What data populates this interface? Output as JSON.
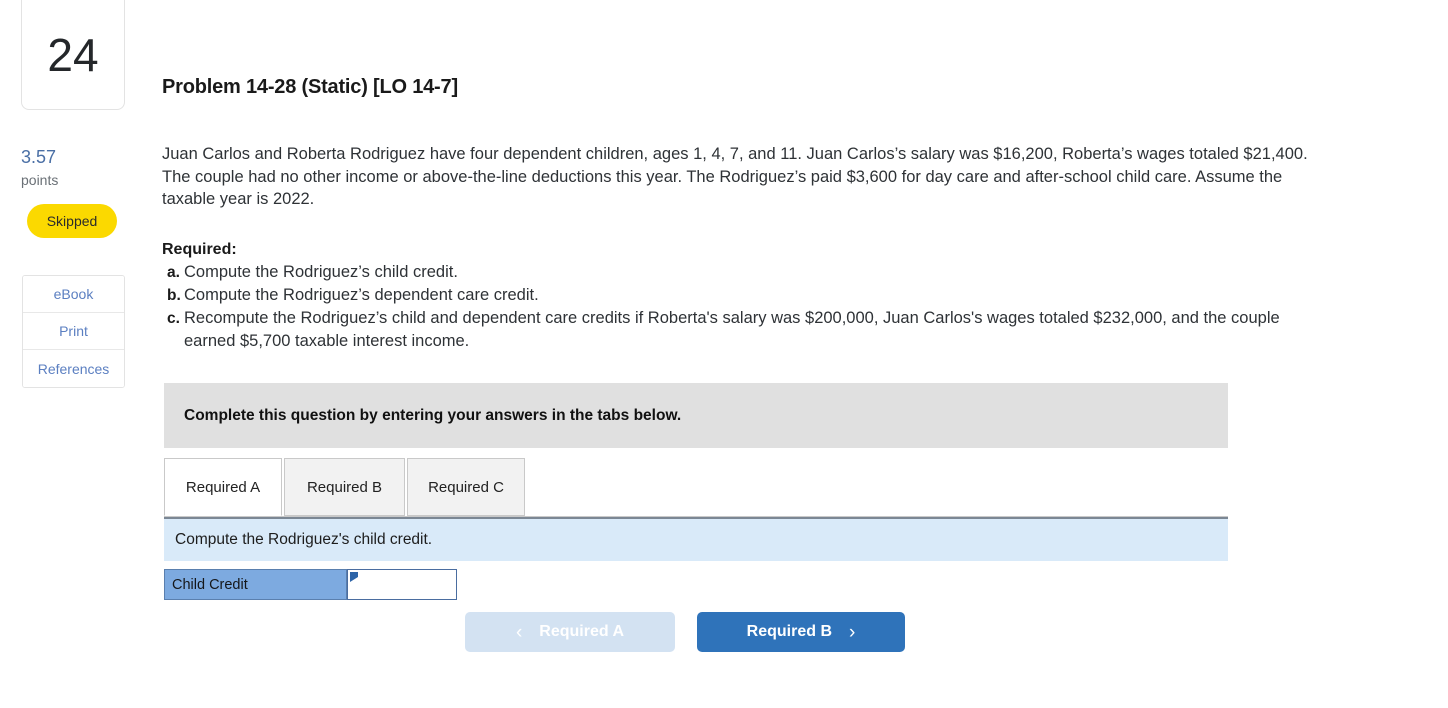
{
  "sidebar": {
    "question_number": "24",
    "points_value": "3.57",
    "points_label": "points",
    "status_badge": "Skipped",
    "tools": [
      {
        "label": "eBook"
      },
      {
        "label": "Print"
      },
      {
        "label": "References"
      }
    ]
  },
  "problem": {
    "title": "Problem 14-28 (Static) [LO 14-7]",
    "body": "Juan Carlos and Roberta Rodriguez have four dependent children, ages 1, 4, 7, and 11. Juan Carlos’s salary was $16,200, Roberta’s wages totaled $21,400. The couple had no other income or above-the-line deductions this year. The Rodriguez’s paid $3,600 for day care and after-school child care. Assume the taxable year is 2022.",
    "required_heading": "Required:",
    "required_items": [
      {
        "letter": "a.",
        "text": "Compute the Rodriguez’s child credit."
      },
      {
        "letter": "b.",
        "text": "Compute the Rodriguez’s dependent care credit."
      },
      {
        "letter": "c.",
        "text": "Recompute the Rodriguez’s child and dependent care credits if Roberta's salary was $200,000, Juan Carlos's wages totaled $232,000, and the couple earned $5,700 taxable interest income."
      }
    ]
  },
  "callout": {
    "text": "Complete this question by entering your answers in the tabs below."
  },
  "tabs": [
    {
      "label": "Required A",
      "active": true
    },
    {
      "label": "Required B",
      "active": false
    },
    {
      "label": "Required C",
      "active": false
    }
  ],
  "prompt": {
    "text": "Compute the Rodriguez's child credit."
  },
  "answer_grid": {
    "row_label": "Child Credit",
    "input_value": "",
    "input_placeholder": ""
  },
  "nav": {
    "prev_label": "Required A",
    "prev_chevron": "‹",
    "next_label": "Required B",
    "next_chevron": "›"
  },
  "colors": {
    "badge_yellow": "#fbd900",
    "link_blue": "#5b7fc1",
    "callout_gray": "#e0e0e0",
    "prompt_blue": "#d9eaf9",
    "row_label_blue": "#7daae0",
    "nav_next_blue": "#2f73ba",
    "nav_prev_blue": "#d3e2f2"
  }
}
